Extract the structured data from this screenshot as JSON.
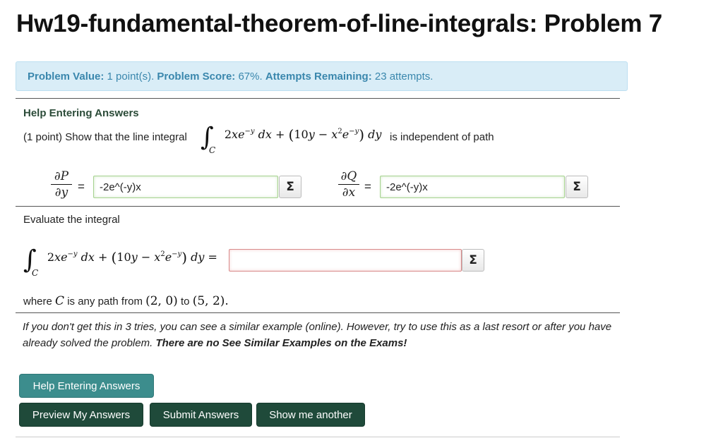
{
  "title": "Hw19-fundamental-theorem-of-line-integrals: Problem 7",
  "info": {
    "value_label": "Problem Value:",
    "value_text": "1 point(s).",
    "score_label": "Problem Score:",
    "score_text": "67%.",
    "attempts_label": "Attempts Remaining:",
    "attempts_text": "23 attempts."
  },
  "help_heading": "Help Entering Answers",
  "problem": {
    "intro": "(1 point) Show that the line integral",
    "independent": "is independent of path",
    "evaluate": "Evaluate the integral",
    "where_prefix": "where",
    "where_mid": "is any path from",
    "to": "to",
    "point_a": "(2, 0)",
    "point_b": "(5, 2)."
  },
  "partials": {
    "p_num": "∂P",
    "p_den": "∂y",
    "q_num": "∂Q",
    "q_den": "∂x",
    "equals": "="
  },
  "answers": {
    "dp_dy": "-2e^(-y)x",
    "dq_dx": "-2e^(-y)x",
    "integral": ""
  },
  "sigma": "Σ",
  "note": {
    "text": "If you don't get this in 3 tries, you can see a similar example (online). However, try to use this as a last resort or after you have already solved the problem.",
    "bold": "There are no See Similar Examples on the Exams!"
  },
  "buttons": {
    "help": "Help Entering Answers",
    "preview": "Preview My Answers",
    "submit": "Submit Answers",
    "another": "Show me another"
  }
}
